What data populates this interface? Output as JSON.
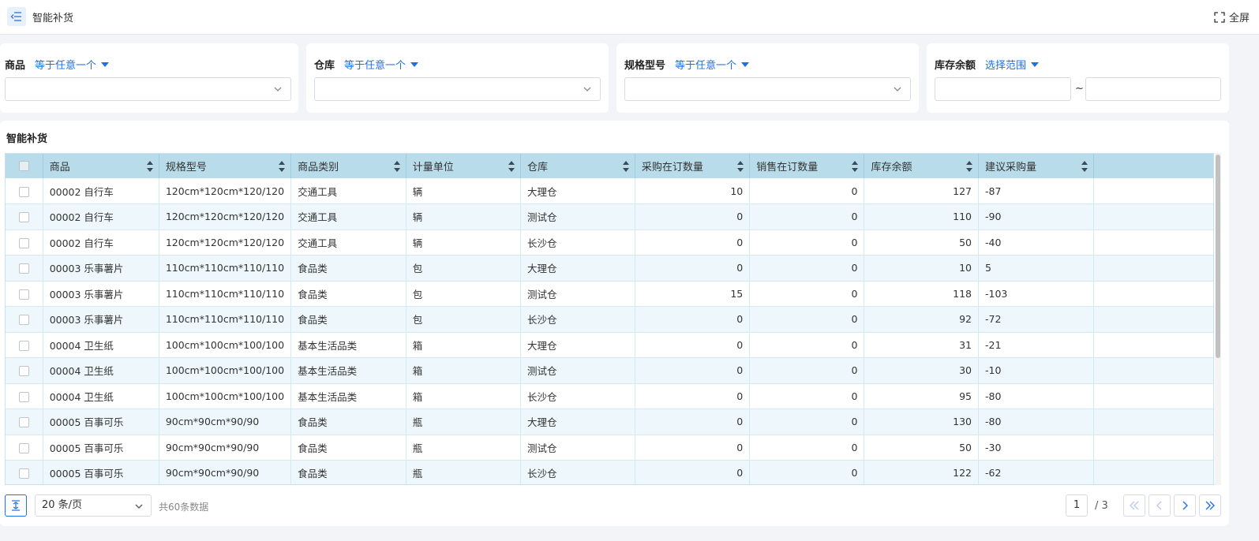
{
  "header": {
    "title": "智能补货",
    "fullscreen_label": "全屏",
    "menu_icon": "menu-collapse-icon"
  },
  "filters": [
    {
      "label": "商品",
      "operator": "等于任意一个",
      "value": ""
    },
    {
      "label": "仓库",
      "operator": "等于任意一个",
      "value": ""
    },
    {
      "label": "规格型号",
      "operator": "等于任意一个",
      "value": ""
    },
    {
      "label": "库存余额",
      "operator": "选择范围",
      "min": "",
      "max": "",
      "separator": "~"
    }
  ],
  "table": {
    "title": "智能补货",
    "columns": [
      "商品",
      "规格型号",
      "商品类别",
      "计量单位",
      "仓库",
      "采购在订数量",
      "销售在订数量",
      "库存余额",
      "建议采购量"
    ],
    "rows": [
      [
        "00002 自行车",
        "120cm*120cm*120/120",
        "交通工具",
        "辆",
        "大理仓",
        "10",
        "0",
        "127",
        "-87"
      ],
      [
        "00002 自行车",
        "120cm*120cm*120/120",
        "交通工具",
        "辆",
        "测试仓",
        "0",
        "0",
        "110",
        "-90"
      ],
      [
        "00002 自行车",
        "120cm*120cm*120/120",
        "交通工具",
        "辆",
        "长沙仓",
        "0",
        "0",
        "50",
        "-40"
      ],
      [
        "00003 乐事薯片",
        "110cm*110cm*110/110",
        "食品类",
        "包",
        "大理仓",
        "0",
        "0",
        "10",
        "5"
      ],
      [
        "00003 乐事薯片",
        "110cm*110cm*110/110",
        "食品类",
        "包",
        "测试仓",
        "15",
        "0",
        "118",
        "-103"
      ],
      [
        "00003 乐事薯片",
        "110cm*110cm*110/110",
        "食品类",
        "包",
        "长沙仓",
        "0",
        "0",
        "92",
        "-72"
      ],
      [
        "00004 卫生纸",
        "100cm*100cm*100/100",
        "基本生活品类",
        "箱",
        "大理仓",
        "0",
        "0",
        "31",
        "-21"
      ],
      [
        "00004 卫生纸",
        "100cm*100cm*100/100",
        "基本生活品类",
        "箱",
        "测试仓",
        "0",
        "0",
        "30",
        "-10"
      ],
      [
        "00004 卫生纸",
        "100cm*100cm*100/100",
        "基本生活品类",
        "箱",
        "长沙仓",
        "0",
        "0",
        "95",
        "-80"
      ],
      [
        "00005 百事可乐",
        "90cm*90cm*90/90",
        "食品类",
        "瓶",
        "大理仓",
        "0",
        "0",
        "130",
        "-80"
      ],
      [
        "00005 百事可乐",
        "90cm*90cm*90/90",
        "食品类",
        "瓶",
        "测试仓",
        "0",
        "0",
        "50",
        "-30"
      ],
      [
        "00005 百事可乐",
        "90cm*90cm*90/90",
        "食品类",
        "瓶",
        "长沙仓",
        "0",
        "0",
        "122",
        "-62"
      ]
    ]
  },
  "pagination": {
    "page_size": "20 条/页",
    "total": "共60条数据",
    "current_page": "1",
    "total_pages": "/ 3"
  },
  "colors": {
    "accent": "#1f6fe0",
    "header_bg": "#b8dcea",
    "row_stripe": "#eef7fb"
  }
}
